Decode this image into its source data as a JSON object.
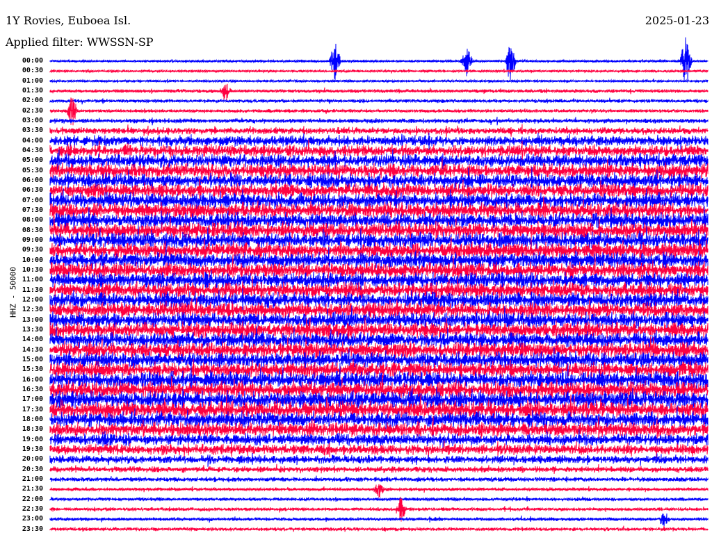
{
  "header": {
    "station": "1Y Rovies, Euboea Isl.",
    "filter": "Applied filter: WWSSN-SP",
    "date": "2025-01-23"
  },
  "chart_data": {
    "type": "line",
    "title": "1Y Rovies, Euboea Isl.",
    "ylabel": "HHZ - 50000",
    "xlabel": "",
    "row_labels": [
      "00:00",
      "00:30",
      "01:00",
      "01:30",
      "02:00",
      "02:30",
      "03:00",
      "03:30",
      "04:00",
      "04:30",
      "05:00",
      "05:30",
      "06:00",
      "06:30",
      "07:00",
      "07:30",
      "08:00",
      "08:30",
      "09:00",
      "09:30",
      "10:00",
      "10:30",
      "11:00",
      "11:30",
      "12:00",
      "12:30",
      "13:00",
      "13:30",
      "14:00",
      "14:30",
      "15:00",
      "15:30",
      "16:00",
      "16:30",
      "17:00",
      "17:30",
      "18:00",
      "18:30",
      "19:00",
      "19:30",
      "20:00",
      "20:30",
      "21:00",
      "21:30",
      "22:00",
      "22:30",
      "23:00",
      "23:30"
    ],
    "row_minutes": 30,
    "series_colors": [
      "#0000ff",
      "#ff0040"
    ],
    "relative_amplitude": [
      2,
      2,
      2,
      3,
      3,
      3,
      4,
      6,
      9,
      10,
      11,
      12,
      12,
      12,
      13,
      13,
      13,
      13,
      13,
      13,
      13,
      13,
      13,
      13,
      13,
      13,
      13,
      13,
      13,
      13,
      13,
      13,
      14,
      14,
      14,
      14,
      13,
      12,
      10,
      9,
      7,
      5,
      4,
      3,
      3,
      3,
      3,
      3
    ],
    "events": [
      {
        "row": 0,
        "minute": 13,
        "amp": 30
      },
      {
        "row": 0,
        "minute": 19,
        "amp": 25
      },
      {
        "row": 0,
        "minute": 21,
        "amp": 35
      },
      {
        "row": 0,
        "minute": 29,
        "amp": 40
      },
      {
        "row": 3,
        "minute": 8,
        "amp": 18
      },
      {
        "row": 5,
        "minute": 1,
        "amp": 25
      },
      {
        "row": 43,
        "minute": 15,
        "amp": 15
      },
      {
        "row": 45,
        "minute": 16,
        "amp": 20
      },
      {
        "row": 46,
        "minute": 28,
        "amp": 15
      }
    ]
  }
}
